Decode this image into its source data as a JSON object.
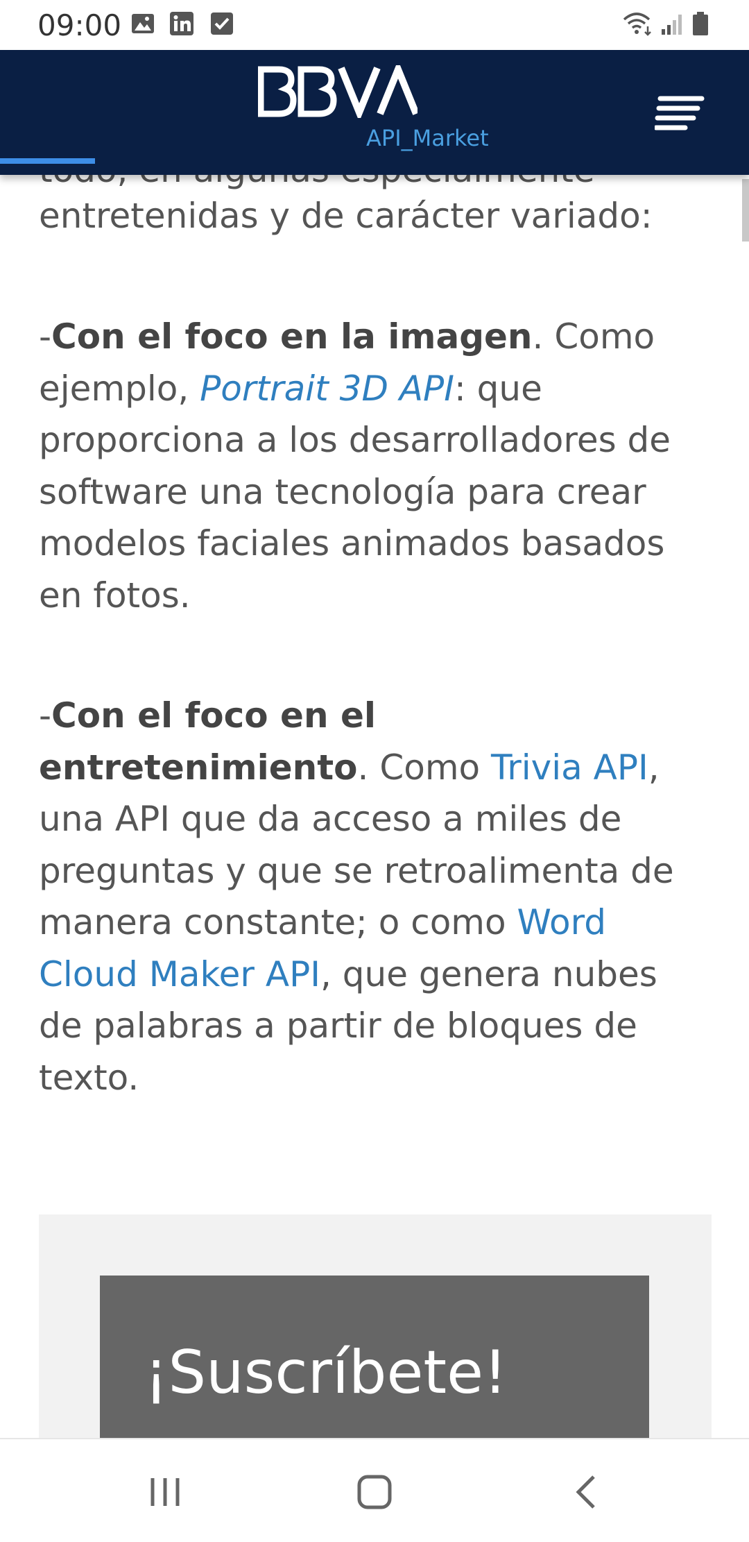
{
  "status_bar": {
    "time": "09:00",
    "icons": [
      "image-icon",
      "linkedin-icon",
      "checkbox-icon",
      "wifi-icon",
      "signal-icon",
      "battery-icon"
    ]
  },
  "header": {
    "logo_text": "BBVA",
    "logo_subtitle": "API_Market",
    "menu_icon": "menu-icon",
    "progress": 0.127,
    "colors": {
      "background": "#0a1f44",
      "accent": "#4a9fe0"
    }
  },
  "article": {
    "cut_line": "todo, en algunas especialmente",
    "intro_line": "entretenidas y de carácter variado:",
    "para1": {
      "dash": "-",
      "heading": "Con el foco en la imagen",
      "after_heading": ". Como ejemplo, ",
      "link": "Portrait 3D API",
      "rest": ": que proporciona a los desarrolladores de software una tecnología para crear modelos faciales animados basados en fotos."
    },
    "para2": {
      "dash": "-",
      "heading": "Con el foco en el entretenimiento",
      "after_heading": ". Como ",
      "link1": "Trivia API",
      "middle": ", una API que da acceso a miles de preguntas y que se retroalimenta de manera constante; o como ",
      "link2": "Word Cloud Maker API",
      "rest": ", que genera nubes de palabras a partir de bloques de texto."
    },
    "colors": {
      "text": "#555555",
      "link": "#2f7fbf"
    }
  },
  "subscribe": {
    "title": "¡Suscríbete!"
  },
  "nav_bar": {
    "buttons": [
      "recent-apps-icon",
      "home-icon",
      "back-icon"
    ]
  }
}
